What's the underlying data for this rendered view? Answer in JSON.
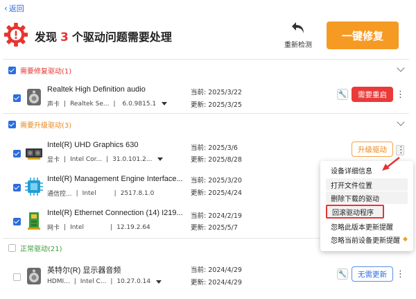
{
  "nav": {
    "back_label": "返回"
  },
  "header": {
    "title_prefix": "发现",
    "issue_count": "3",
    "title_suffix": "个驱动问题需要处理",
    "recheck_label": "重新检测",
    "fix_button_label": "一键修复"
  },
  "colors": {
    "accent_blue": "#2b6de0",
    "warning_red": "#e8342f",
    "upgrade_orange": "#e8891a",
    "ok_green": "#3a9a3a",
    "primary_button": "#f59a23"
  },
  "sections": {
    "repair": {
      "label": "需要修复驱动(1)"
    },
    "upgrade": {
      "label": "需要升级驱动(3)"
    },
    "normal": {
      "label": "正常驱动(21)"
    }
  },
  "devices": [
    {
      "name": "Realtek High Definition audio",
      "type": "声卡",
      "vendor": "Realtek Se...",
      "version": "6.0.9815.1",
      "current_label": "当前:",
      "current_date": "2025/3/22",
      "update_label": "更新:",
      "update_date": "2025/3/25",
      "action": "需要重启",
      "icon": "speaker-icon"
    },
    {
      "name": "Intel(R) UHD Graphics 630",
      "type": "显卡",
      "vendor": "Intel Cor...",
      "version": "31.0.101.2...",
      "current_label": "当前:",
      "current_date": "2025/3/6",
      "update_label": "更新:",
      "update_date": "2025/8/28",
      "action": "升级驱动",
      "icon": "graphics-card-icon"
    },
    {
      "name": "Intel(R) Management Engine Interface...",
      "type": "通信控...",
      "vendor": "Intel",
      "version": "2517.8.1.0",
      "current_label": "当前:",
      "current_date": "2025/3/20",
      "update_label": "更新:",
      "update_date": "2025/4/24",
      "icon": "chip-icon"
    },
    {
      "name": "Intel(R) Ethernet Connection (14) I219...",
      "type": "网卡",
      "vendor": "Intel",
      "version": "12.19.2.64",
      "current_label": "当前:",
      "current_date": "2024/2/19",
      "update_label": "更新:",
      "update_date": "2025/5/7",
      "icon": "network-card-icon"
    },
    {
      "name": "英特尔(R) 显示器音频",
      "type": "HDMI...",
      "vendor": "Intel C...",
      "version": "10.27.0.14",
      "current_label": "当前:",
      "current_date": "2024/4/29",
      "update_label": "更新:",
      "update_date": "2024/4/29",
      "action": "无需更新",
      "icon": "speaker-icon"
    }
  ],
  "context_menu": {
    "items": [
      {
        "label": "设备详细信息"
      },
      {
        "label": "打开文件位置"
      },
      {
        "label": "删除下载的驱动"
      },
      {
        "label": "回滚驱动程序"
      },
      {
        "label": "忽略此版本更新提醒"
      },
      {
        "label": "忽略当前设备更新提醒"
      }
    ]
  },
  "ui_glyphs": {
    "back_chevron": "‹",
    "more": "⋮",
    "wrench": "🔧",
    "premium": "◆",
    "separator": "|"
  }
}
